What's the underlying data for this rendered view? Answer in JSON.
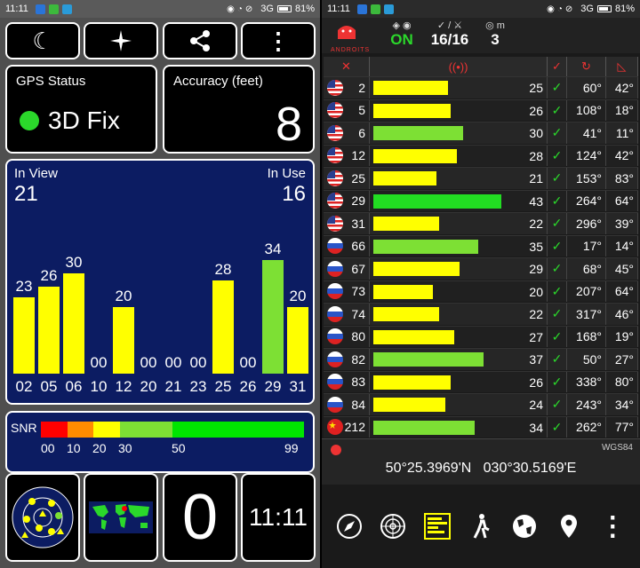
{
  "status_left": {
    "time": "11:11",
    "network": "3G",
    "battery": "81%"
  },
  "status_right": {
    "time": "11:11",
    "network": "3G",
    "battery": "81%"
  },
  "toolbar": {
    "night_icon": "moon-icon",
    "compass_icon": "compass-rose-icon",
    "share_icon": "share-icon",
    "more_icon": "more-vertical-icon"
  },
  "gps_status": {
    "label": "GPS Status",
    "value": "3D Fix",
    "color": "#2bd82b"
  },
  "accuracy": {
    "label": "Accuracy (feet)",
    "value": "8"
  },
  "in_view": {
    "label": "In View",
    "value": "21",
    "in_use_label": "In Use",
    "in_use_value": "16"
  },
  "chart_data": {
    "type": "bar",
    "categories": [
      "02",
      "05",
      "06",
      "10",
      "12",
      "20",
      "21",
      "23",
      "25",
      "26",
      "29",
      "31"
    ],
    "values": [
      23,
      26,
      30,
      0,
      20,
      0,
      0,
      0,
      28,
      0,
      34,
      20
    ],
    "value_labels": [
      "23",
      "26",
      "30",
      "00",
      "20",
      "00",
      "00",
      "00",
      "28",
      "00",
      "34",
      "20"
    ],
    "colors": [
      "#ffff00",
      "#ffff00",
      "#ffff00",
      "#ffff00",
      "#ffff00",
      "#ffff00",
      "#ffff00",
      "#ffff00",
      "#ffff00",
      "#ffff00",
      "#7de034",
      "#ffff00"
    ],
    "ylim": [
      0,
      99
    ]
  },
  "snr": {
    "label": "SNR",
    "ticks": [
      "00",
      "10",
      "20",
      "30",
      "50",
      "99"
    ]
  },
  "bottom": {
    "zero": "0",
    "clock": "11:11"
  },
  "right": {
    "brand": "ANDROITS",
    "status": "ON",
    "used": "16/16",
    "m_value": "3",
    "datum": "WGS84",
    "latitude": "50°25.3969'N",
    "longitude": "030°30.5169'E",
    "rows": [
      {
        "prn": "2",
        "snr": 25,
        "az": "60°",
        "el": "42°",
        "flag": "us"
      },
      {
        "prn": "5",
        "snr": 26,
        "az": "108°",
        "el": "18°",
        "flag": "us"
      },
      {
        "prn": "6",
        "snr": 30,
        "az": "41°",
        "el": "11°",
        "flag": "us"
      },
      {
        "prn": "12",
        "snr": 28,
        "az": "124°",
        "el": "42°",
        "flag": "us"
      },
      {
        "prn": "25",
        "snr": 21,
        "az": "153°",
        "el": "83°",
        "flag": "us"
      },
      {
        "prn": "29",
        "snr": 43,
        "az": "264°",
        "el": "64°",
        "flag": "us"
      },
      {
        "prn": "31",
        "snr": 22,
        "az": "296°",
        "el": "39°",
        "flag": "us"
      },
      {
        "prn": "66",
        "snr": 35,
        "az": "17°",
        "el": "14°",
        "flag": "ru"
      },
      {
        "prn": "67",
        "snr": 29,
        "az": "68°",
        "el": "45°",
        "flag": "ru"
      },
      {
        "prn": "73",
        "snr": 20,
        "az": "207°",
        "el": "64°",
        "flag": "ru"
      },
      {
        "prn": "74",
        "snr": 22,
        "az": "317°",
        "el": "46°",
        "flag": "ru"
      },
      {
        "prn": "80",
        "snr": 27,
        "az": "168°",
        "el": "19°",
        "flag": "ru"
      },
      {
        "prn": "82",
        "snr": 37,
        "az": "50°",
        "el": "27°",
        "flag": "ru"
      },
      {
        "prn": "83",
        "snr": 26,
        "az": "338°",
        "el": "80°",
        "flag": "ru"
      },
      {
        "prn": "84",
        "snr": 24,
        "az": "243°",
        "el": "34°",
        "flag": "ru"
      },
      {
        "prn": "212",
        "snr": 34,
        "az": "262°",
        "el": "77°",
        "flag": "cn"
      }
    ]
  }
}
